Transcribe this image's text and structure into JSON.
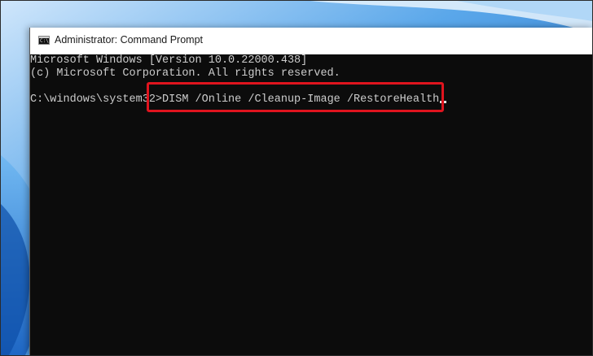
{
  "window": {
    "title": "Administrator: Command Prompt",
    "icon": "cmd-icon",
    "icon_glyph": "C:\\"
  },
  "console": {
    "lines": [
      "Microsoft Windows [Version 10.0.22000.438]",
      "(c) Microsoft Corporation. All rights reserved."
    ],
    "prompt": "C:\\windows\\system32>",
    "command": "DISM /Online /Cleanup-Image /RestoreHealth"
  },
  "colors": {
    "console_bg": "#0c0c0c",
    "console_text": "#cccccc",
    "highlight": "#e0141e",
    "desktop": "#1677c9"
  }
}
